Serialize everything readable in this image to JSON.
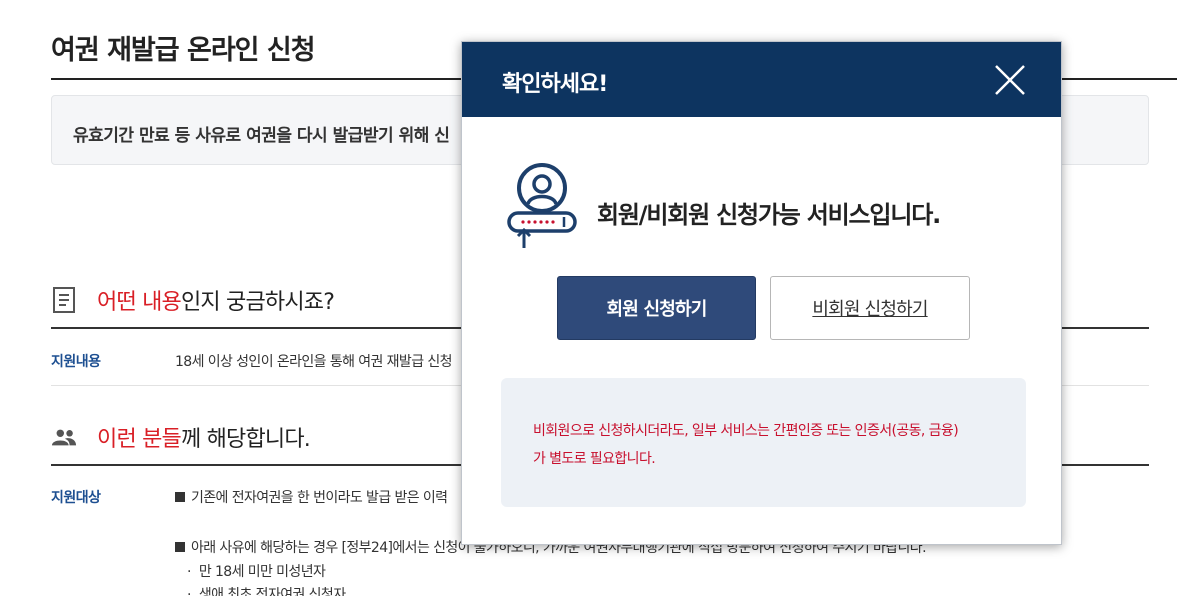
{
  "page": {
    "title": "여권 재발급 온라인 신청",
    "notice": "유효기간 만료 등 사유로 여권을 다시 발급받기 위해 신"
  },
  "section1": {
    "highlight": "어떤 내용",
    "rest": "인지 궁금하시죠?",
    "icon": "document-icon",
    "rows": [
      {
        "label": "지원내용",
        "value": "18세 이상 성인이 온라인을 통해 여권 재발급 신청"
      }
    ]
  },
  "section2": {
    "highlight": "이런 분들",
    "rest": "께 해당합니다.",
    "icon": "people-icon",
    "label": "지원대상",
    "item1": "기존에 전자여권을 한 번이라도 발급 받은 이력",
    "item2": "아래 사유에 해당하는 경우 [정부24]에서는 신청이 불가하오니, 가까운 여권사무대행기관에 직접 방문하여 신청하여 주시기 바랍니다.",
    "sub1": "만 18세 미만 미성년자",
    "sub2": "생애 최초 전자여권 신청자",
    "bullet": "·"
  },
  "modal": {
    "title": "확인하세요!",
    "close_icon": "close-icon",
    "service_icon": "user-login-icon",
    "message": "회원/비회원 신청가능 서비스입니다.",
    "member_button": "회원 신청하기",
    "guest_button": "비회원 신청하기",
    "info_line1": "비회원으로 신청하시더라도, 일부 서비스는 간편인증 또는 인증서(공동, 금융)",
    "info_line2": "가 별도로 필요합니다."
  },
  "colors": {
    "header_bg": "#0d3460",
    "member_button_bg": "#2f4a7a",
    "highlight_red": "#d91f26",
    "label_blue": "#1d4f91",
    "info_red": "#c8102e"
  }
}
